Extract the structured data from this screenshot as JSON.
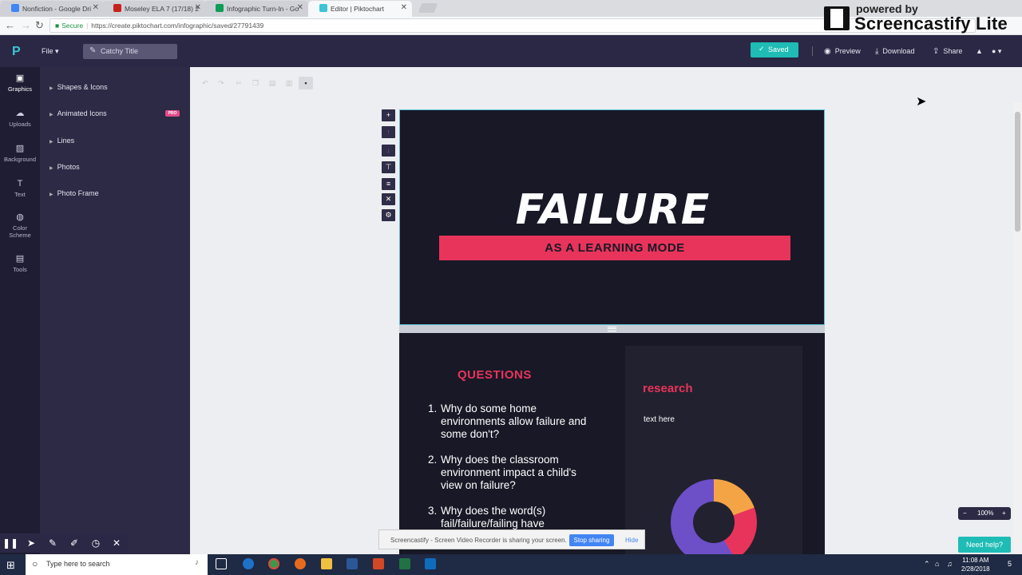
{
  "browser": {
    "tabs": [
      {
        "title": "Nonfiction - Google Dri",
        "color": "#4285f4"
      },
      {
        "title": "Moseley ELA 7 (17/18) 2",
        "color": "#c5221f"
      },
      {
        "title": "Infographic Turn-In - Go",
        "color": "#0f9d58"
      },
      {
        "title": "Editor | Piktochart",
        "color": "#3cc4d4"
      }
    ],
    "secure_label": "Secure",
    "url": "https://create.piktochart.com/infographic/saved/27791439"
  },
  "watermark": {
    "small": "powered by",
    "big": "Screencastify Lite"
  },
  "topbar": {
    "logo": "P",
    "file_label": "File",
    "title_placeholder": "Catchy Title",
    "saved_label": "Saved",
    "preview_label": "Preview",
    "download_label": "Download",
    "share_label": "Share"
  },
  "rail": [
    {
      "label": "Graphics",
      "icon": "graphics-icon"
    },
    {
      "label": "Uploads",
      "icon": "cloud-upload-icon"
    },
    {
      "label": "Background",
      "icon": "background-icon"
    },
    {
      "label": "Text",
      "icon": "text-icon"
    },
    {
      "label": "Color Scheme",
      "icon": "palette-icon"
    },
    {
      "label": "Tools",
      "icon": "toolbox-icon"
    }
  ],
  "panel": {
    "items": [
      "Shapes & Icons",
      "Animated Icons",
      "Lines",
      "Photos",
      "Photo Frame"
    ],
    "pro_badge": "PRO"
  },
  "canvas": {
    "title": "FAILURE",
    "subtitle": "AS A LEARNING MODE",
    "questions_heading": "QUESTIONS",
    "questions": [
      {
        "num": "1.",
        "text": "Why do some home environments allow failure and some don't?"
      },
      {
        "num": "2.",
        "text": "Why does the classroom environment impact a child's view on failure?"
      },
      {
        "num": "3.",
        "text": "Why does the word(s) fail/failure/failing have"
      }
    ],
    "research_heading": "research",
    "research_text": "text here",
    "accent": "#e8345b"
  },
  "zoom": {
    "minus": "−",
    "value": "100%",
    "plus": "+"
  },
  "help_label": "Need help?",
  "screencastify_bar": {
    "text": "Screencastify - Screen Video Recorder is sharing your screen.",
    "stop_label": "Stop sharing",
    "hide_label": "Hide"
  },
  "taskbar": {
    "search_placeholder": "Type here to search",
    "time": "11:08 AM",
    "date": "2/28/2018",
    "notifications": "5"
  }
}
